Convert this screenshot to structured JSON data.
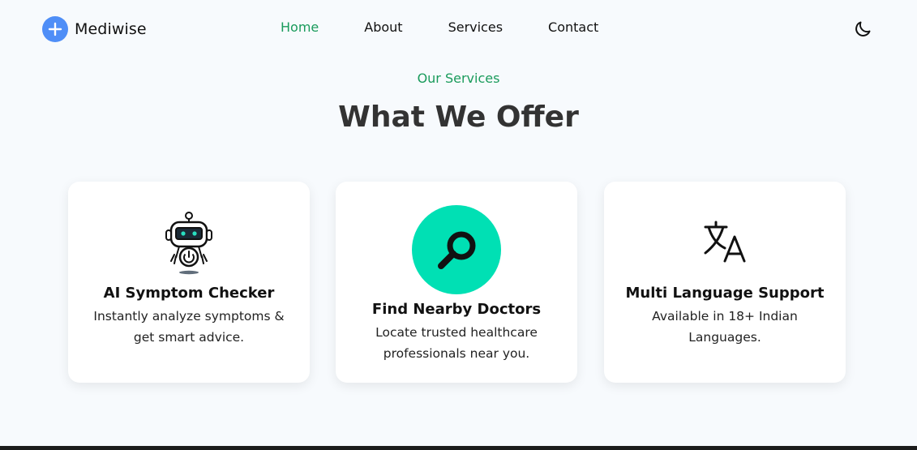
{
  "brand": {
    "name": "Mediwise",
    "accent": "#4f8ef7"
  },
  "nav": {
    "items": [
      {
        "label": "Home",
        "active": true
      },
      {
        "label": "About",
        "active": false
      },
      {
        "label": "Services",
        "active": false
      },
      {
        "label": "Contact",
        "active": false
      }
    ],
    "theme_toggle_icon": "moon-icon",
    "active_color": "#1a9b5c"
  },
  "section": {
    "eyebrow": "Our Services",
    "title": "What We Offer"
  },
  "cards": [
    {
      "icon": "robot-icon",
      "title": "AI Symptom Checker",
      "desc_line1": "Instantly analyze symptoms &",
      "desc_line2": "get smart advice."
    },
    {
      "icon": "search-icon",
      "title": "Find Nearby Doctors",
      "desc_line1": "Locate trusted healthcare",
      "desc_line2": "professionals near you.",
      "icon_bg": "#00e0b4"
    },
    {
      "icon": "translate-icon",
      "title": "Multi Language Support",
      "desc_line1": "Available in 18+ Indian",
      "desc_line2": "Languages."
    }
  ]
}
